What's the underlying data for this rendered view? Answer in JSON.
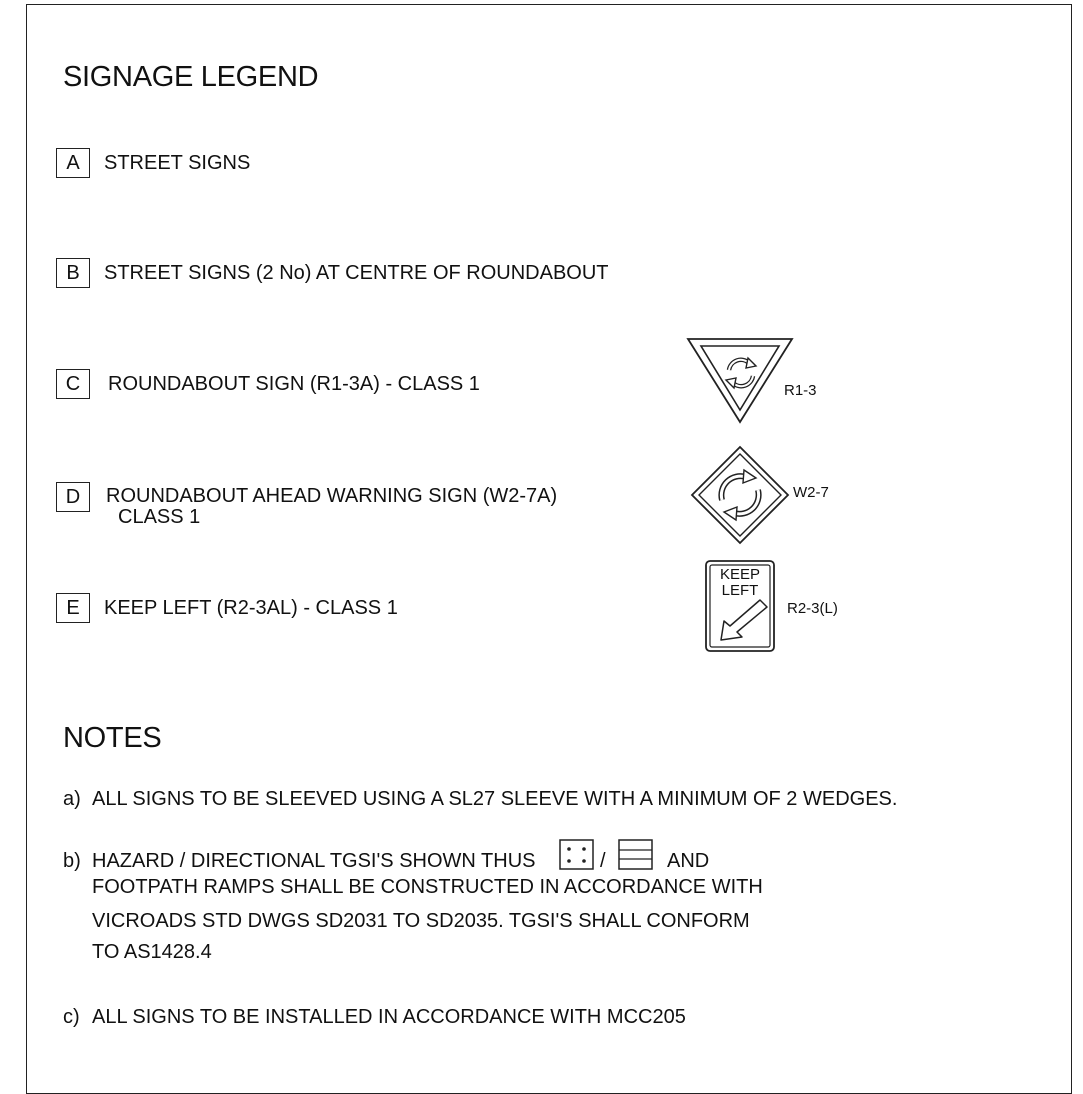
{
  "legend": {
    "title": "SIGNAGE LEGEND",
    "items": [
      {
        "code": "A",
        "text": "STREET SIGNS"
      },
      {
        "code": "B",
        "text": "STREET SIGNS (2 No) AT CENTRE OF ROUNDABOUT"
      },
      {
        "code": "C",
        "text": "ROUNDABOUT SIGN (R1-3A) - CLASS 1",
        "sign_label": "R1-3",
        "sign_icon": "roundabout-give-way-triangle-icon"
      },
      {
        "code": "D",
        "text": "ROUNDABOUT AHEAD WARNING SIGN (W2-7A)",
        "text2": "CLASS 1",
        "sign_label": "W2-7",
        "sign_icon": "roundabout-ahead-diamond-icon"
      },
      {
        "code": "E",
        "text": "KEEP LEFT (R2-3AL) - CLASS 1",
        "sign_label": "R2-3(L)",
        "sign_icon": "keep-left-sign-icon",
        "sign_text": [
          "KEEP",
          "LEFT"
        ]
      }
    ]
  },
  "notes": {
    "title": "NOTES",
    "items": [
      {
        "marker": "a)",
        "lines": [
          "ALL SIGNS TO BE SLEEVED USING A SL27 SLEEVE WITH A MINIMUM OF 2 WEDGES."
        ]
      },
      {
        "marker": "b)",
        "line1_before": "HAZARD / DIRECTIONAL TGSI'S SHOWN THUS",
        "line1_sep": "/",
        "line1_after": "AND",
        "lines": [
          "FOOTPATH RAMPS SHALL BE CONSTRUCTED IN ACCORDANCE WITH",
          "VICROADS STD DWGS SD2031 TO SD2035. TGSI'S SHALL CONFORM",
          "TO AS1428.4"
        ],
        "icons": [
          "hazard-tgsi-dots-icon",
          "directional-tgsi-lines-icon"
        ]
      },
      {
        "marker": "c)",
        "lines": [
          "ALL SIGNS TO BE INSTALLED IN ACCORDANCE WITH MCC205"
        ]
      }
    ]
  },
  "colors": {
    "line": "#222222",
    "background": "#ffffff"
  }
}
